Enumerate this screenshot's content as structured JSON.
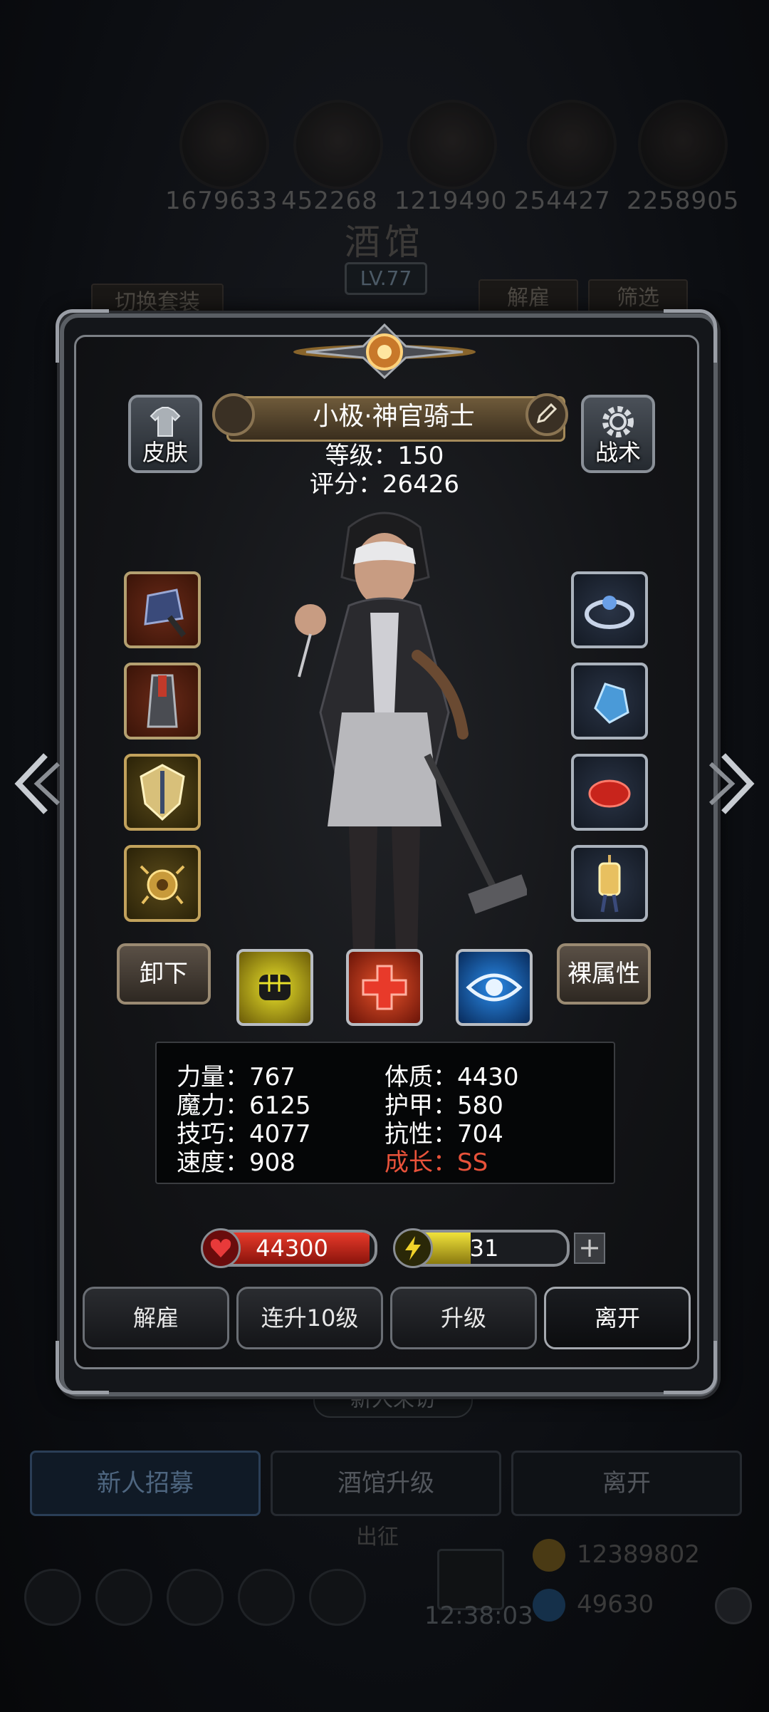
{
  "background": {
    "resources": [
      "1679633",
      "452268",
      "1219490",
      "254427",
      "2258905"
    ],
    "title": "酒馆",
    "level": "LV.77",
    "switch_set_label": "切换套装",
    "dismiss_label": "解雇",
    "filter_label": "筛选",
    "new_visitor_label": "新人来访",
    "bottom_buttons": [
      "新人招募",
      "酒馆升级",
      "离开"
    ],
    "expedition_label": "出征",
    "gold": "12389802",
    "gems": "49630",
    "clock": "12:38:03"
  },
  "hero": {
    "name": "小极·神官骑士",
    "level_line": "等级：150",
    "score_line": "评分：26426",
    "skin_label": "皮肤",
    "tactics_label": "战术",
    "unequip_label": "卸下",
    "bare_stats_label": "裸属性"
  },
  "stats": {
    "strength": "力量：767",
    "constitution": "体质：4430",
    "magic": "魔力：6125",
    "armor": "护甲：580",
    "skill": "技巧：4077",
    "resistance": "抗性：704",
    "speed": "速度：908",
    "growth": "成长：SS"
  },
  "bars": {
    "hp": "44300",
    "hp_fill": 0.97,
    "energy": "31",
    "energy_fill": 0.42
  },
  "actions": [
    "解雇",
    "连升10级",
    "升级",
    "离开"
  ],
  "equipment_left": [
    "helmet-slot",
    "armor-slot",
    "shield-slot",
    "amulet-slot"
  ],
  "equipment_right": [
    "ring-slot",
    "gem-slot",
    "stone-slot",
    "lantern-slot"
  ],
  "skills": [
    "fist-skill-icon",
    "heal-cross-skill-icon",
    "eye-skill-icon"
  ],
  "colors": {
    "accent_gold": "#a48a5a",
    "hp_red": "#c8241c",
    "energy_yellow": "#d8c82a",
    "growth_red": "#e8523a"
  }
}
